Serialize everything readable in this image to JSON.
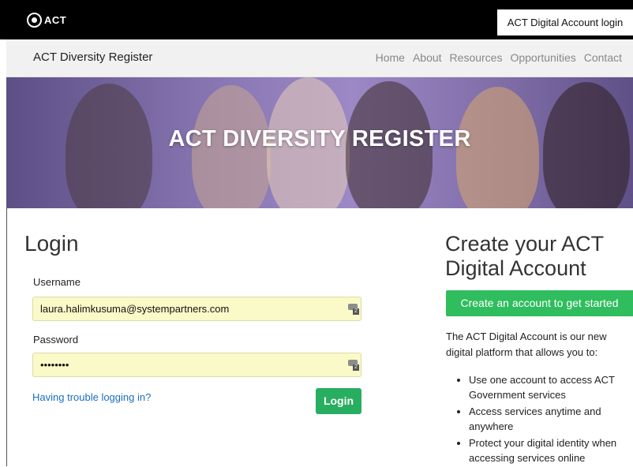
{
  "gov_bar": {
    "logo_text": "ACT",
    "login_label": "ACT Digital Account login"
  },
  "nav": {
    "brand": "ACT Diversity Register",
    "links": [
      "Home",
      "About",
      "Resources",
      "Opportunities",
      "Contact"
    ]
  },
  "hero": {
    "title": "ACT DIVERSITY REGISTER"
  },
  "login": {
    "heading": "Login",
    "username_label": "Username",
    "username_value": "laura.halimkusuma@systempartners.com",
    "password_label": "Password",
    "password_value": "••••••••",
    "trouble_link": "Having trouble logging in?",
    "submit_label": "Login",
    "password_manager_badge": "2"
  },
  "create": {
    "heading": "Create your ACT Digital Account",
    "button_label": "Create an account to get started",
    "description": "The ACT Digital Account is our new digital platform that allows you to:",
    "bullets": [
      "Use one account to access ACT Government services",
      "Access services anytime and anywhere",
      "Protect your digital identity when accessing services online"
    ]
  },
  "colors": {
    "accent_green": "#27ae60",
    "link_blue": "#1a6fc2",
    "autofill_yellow": "#fafac8",
    "hero_purple": "#8a78b4"
  }
}
